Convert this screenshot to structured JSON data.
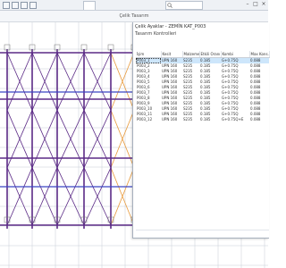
{
  "titlebar": {
    "doc_tab": "",
    "search_placeholder": ""
  },
  "toolstrip": {
    "title": "Çelik Tasarım"
  },
  "panel": {
    "title": "Çelik Ayaklar - ZEMİN KAT_P003",
    "subtitle": "Tasarım Kontrolleri",
    "columns": [
      "İşim",
      "Kesit",
      "Malzeme",
      "Etkili Oranı",
      "Kombi",
      "Max Kons."
    ],
    "rows": [
      [
        "P003_1",
        "UPN 160",
        "S235",
        "0.185",
        "G+0.75Q",
        "0.088"
      ],
      [
        "P003_2",
        "UPN 160",
        "S235",
        "0.185",
        "G+0.75Q",
        "0.088"
      ],
      [
        "P003_3",
        "UPN 160",
        "S235",
        "0.185",
        "G+0.75Q",
        "0.088"
      ],
      [
        "P003_4",
        "UPN 160",
        "S235",
        "0.185",
        "G+0.75Q",
        "0.088"
      ],
      [
        "P003_5",
        "UPN 160",
        "S235",
        "0.185",
        "G+0.75Q",
        "0.088"
      ],
      [
        "P003_6",
        "UPN 160",
        "S235",
        "0.185",
        "G+0.75Q",
        "0.088"
      ],
      [
        "P003_7",
        "UPN 160",
        "S235",
        "0.185",
        "G+0.75Q",
        "0.088"
      ],
      [
        "P003_8",
        "UPN 160",
        "S235",
        "0.185",
        "G+0.75Q",
        "0.088"
      ],
      [
        "P003_9",
        "UPN 160",
        "S235",
        "0.185",
        "G+0.75Q",
        "0.088"
      ],
      [
        "P003_10",
        "UPN 160",
        "S235",
        "0.185",
        "G+0.75Q",
        "0.088"
      ],
      [
        "P003_11",
        "UPN 160",
        "S235",
        "0.185",
        "G+0.75Q",
        "0.088"
      ],
      [
        "P003_12",
        "UPN 160",
        "S235",
        "0.185",
        "G+0.75Q+E",
        "0.088"
      ]
    ],
    "selected_row": 0
  },
  "colors": {
    "purple": "#5b2a86",
    "orange": "#e89a3c",
    "blue": "#3b44c4",
    "grid": "#c7cdd6"
  },
  "icons": [
    "search-icon",
    "minimize-icon",
    "maximize-icon",
    "close-icon"
  ]
}
